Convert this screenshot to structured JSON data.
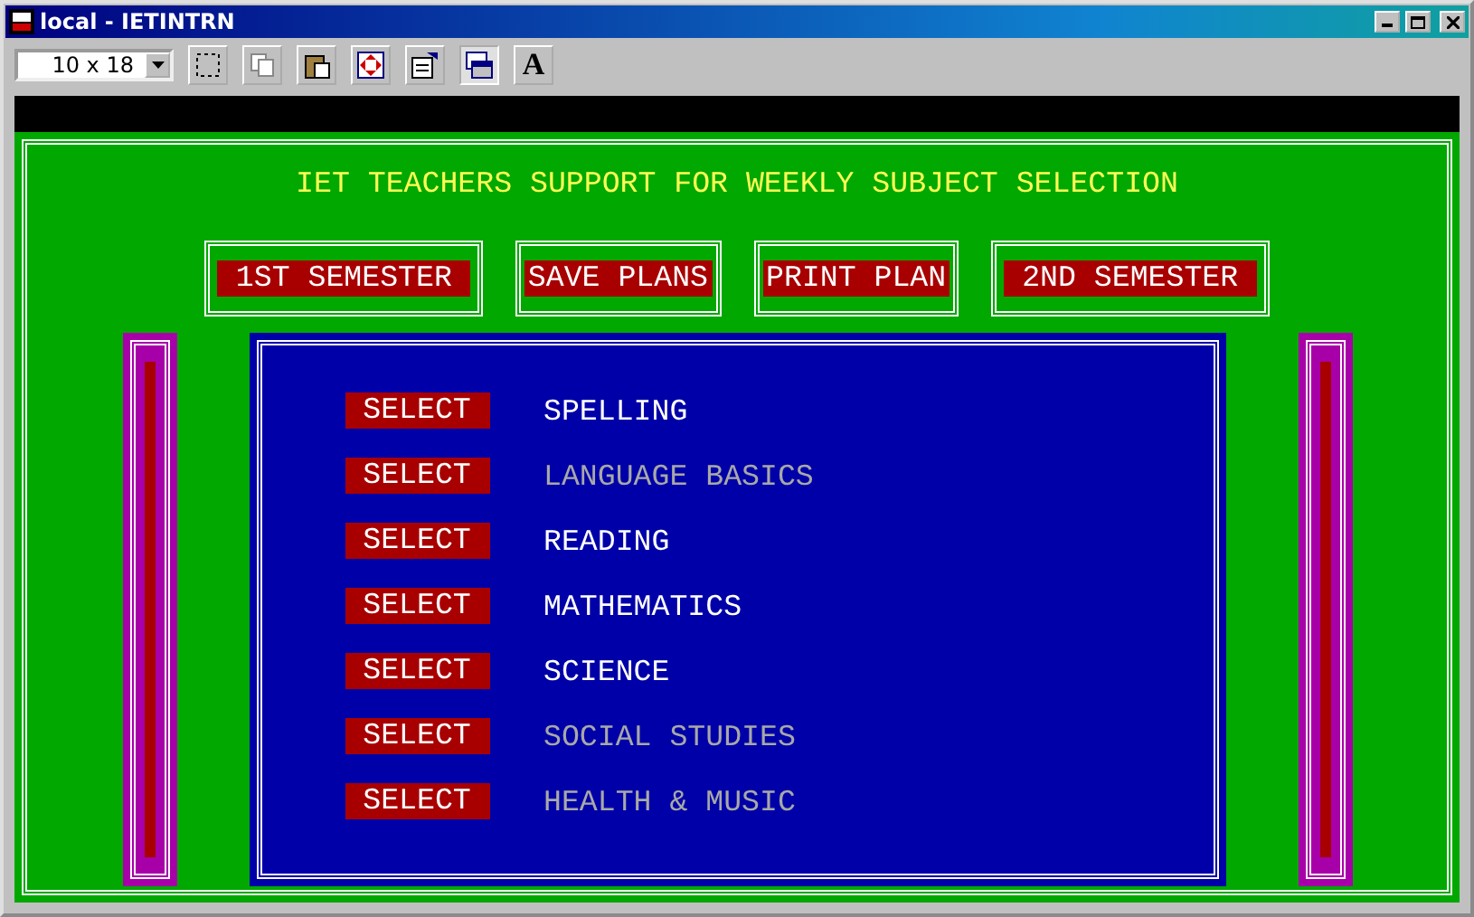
{
  "window": {
    "title": "local - IETINTRN"
  },
  "toolbar": {
    "font_size": "10 x 18",
    "buttons": [
      {
        "kind": "mark",
        "selected": false
      },
      {
        "kind": "copy",
        "selected": false
      },
      {
        "kind": "paste",
        "selected": false
      },
      {
        "kind": "fullscreen",
        "selected": false
      },
      {
        "kind": "properties",
        "selected": false
      },
      {
        "kind": "background",
        "selected": true
      },
      {
        "kind": "font",
        "label": "A",
        "selected": false
      }
    ]
  },
  "screen": {
    "heading": "IET TEACHERS SUPPORT FOR WEEKLY SUBJECT SELECTION",
    "buttons": [
      {
        "label": "1ST SEMESTER",
        "padded": true
      },
      {
        "label": "SAVE PLANS",
        "padded": false
      },
      {
        "label": "PRINT PLAN",
        "padded": false
      },
      {
        "label": "2ND SEMESTER",
        "padded": true
      }
    ],
    "subjects": [
      {
        "action": "SELECT",
        "name": "SPELLING",
        "disabled": false
      },
      {
        "action": "SELECT",
        "name": "LANGUAGE BASICS",
        "disabled": true
      },
      {
        "action": "SELECT",
        "name": "READING",
        "disabled": false
      },
      {
        "action": "SELECT",
        "name": "MATHEMATICS",
        "disabled": false
      },
      {
        "action": "SELECT",
        "name": "SCIENCE",
        "disabled": false
      },
      {
        "action": "SELECT",
        "name": "SOCIAL STUDIES",
        "disabled": true
      },
      {
        "action": "SELECT",
        "name": "HEALTH & MUSIC",
        "disabled": true
      }
    ]
  }
}
